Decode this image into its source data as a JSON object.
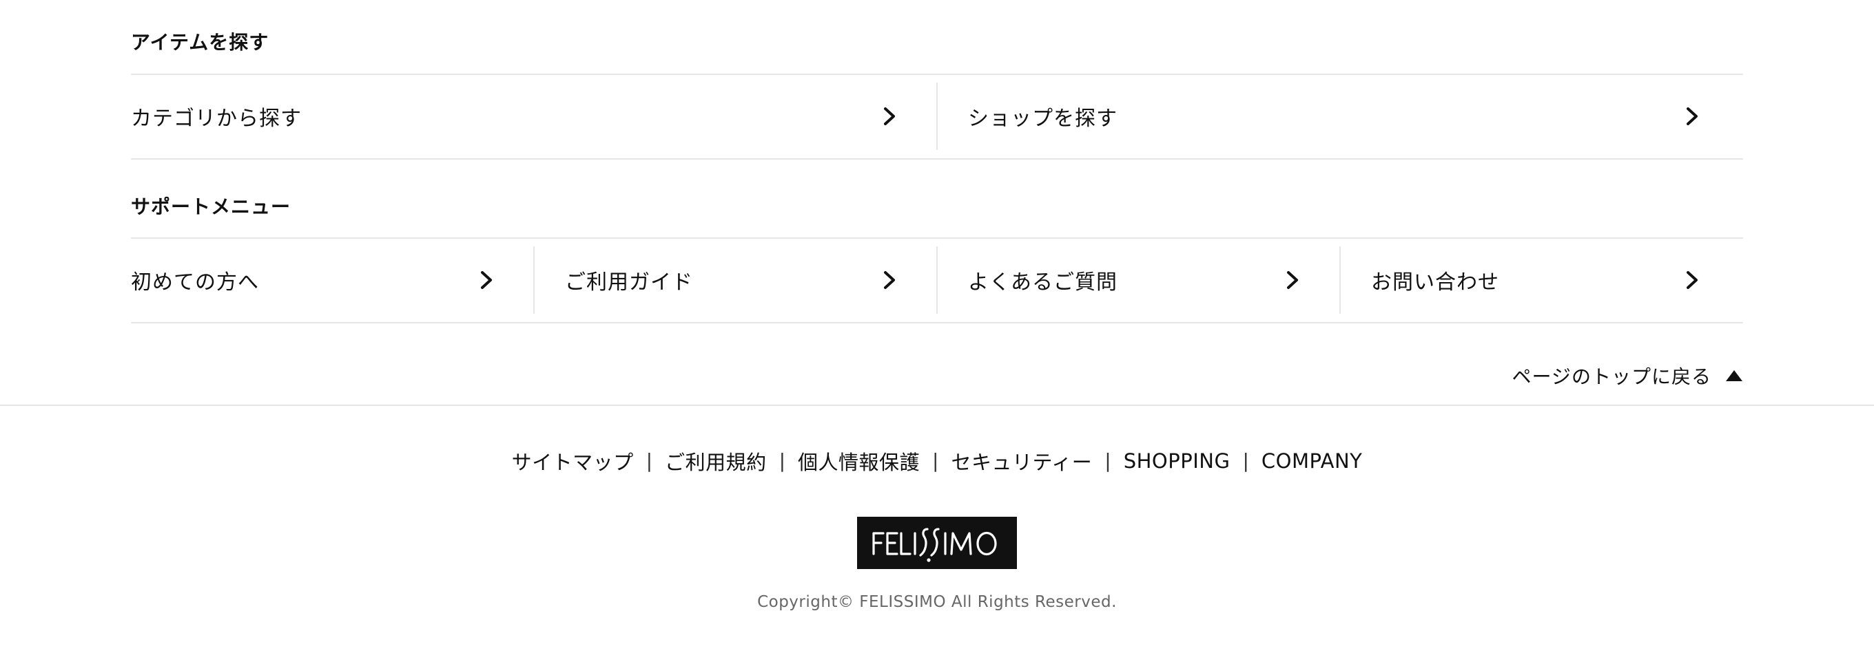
{
  "find_items": {
    "title": "アイテムを探す",
    "links": [
      {
        "label": "カテゴリから探す"
      },
      {
        "label": "ショップを探す"
      }
    ]
  },
  "support_menu": {
    "title": "サポートメニュー",
    "links": [
      {
        "label": "初めての方へ"
      },
      {
        "label": "ご利用ガイド"
      },
      {
        "label": "よくあるご質問"
      },
      {
        "label": "お問い合わせ"
      }
    ]
  },
  "page_top": {
    "label": "ページのトップに戻る",
    "icon": "triangle-up-icon"
  },
  "footer": {
    "links": [
      {
        "label": "サイトマップ"
      },
      {
        "label": "ご利用規約"
      },
      {
        "label": "個人情報保護"
      },
      {
        "label": "セキュリティー"
      },
      {
        "label": "SHOPPING"
      },
      {
        "label": "COMPANY"
      }
    ],
    "separator": "|",
    "logo_text": "FELISSIMO",
    "copyright": "Copyright© FELISSIMO All Rights Reserved."
  },
  "icons": {
    "chevron": "chevron-right-icon"
  },
  "colors": {
    "text": "#111111",
    "divider": "#e6e6e6",
    "logo_bg": "#111111",
    "logo_fg": "#ffffff",
    "copyright": "#666666"
  }
}
